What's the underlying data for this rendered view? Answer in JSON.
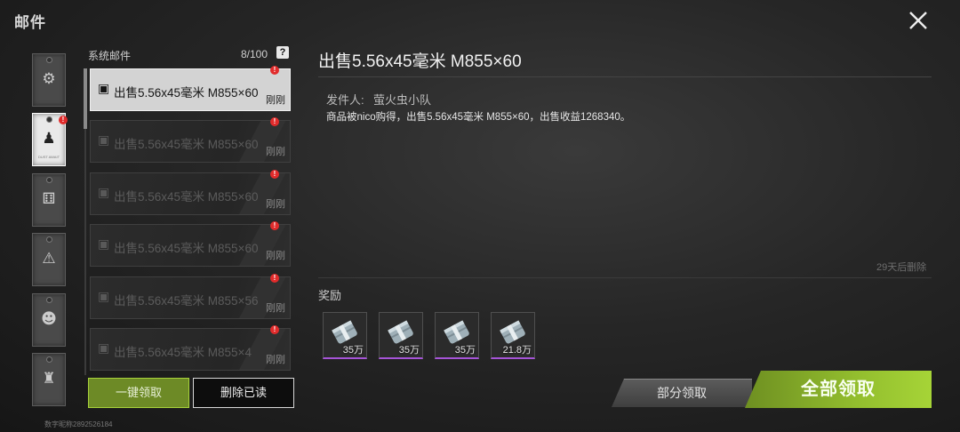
{
  "header": {
    "title": "邮件"
  },
  "tabs": [
    {
      "icon": "gear-icon",
      "glyph": "⚙",
      "active": false,
      "badge": ""
    },
    {
      "icon": "hazard-person-icon",
      "glyph": "♟",
      "active": true,
      "badge": "!",
      "caption": "DUST AWAIT"
    },
    {
      "icon": "dice-icon",
      "glyph": "⚅",
      "active": false,
      "badge": ""
    },
    {
      "icon": "warning-icon",
      "glyph": "⚠",
      "active": false,
      "badge": ""
    },
    {
      "icon": "helmet-icon",
      "glyph": "☻",
      "active": false,
      "badge": ""
    },
    {
      "icon": "backpack-icon",
      "glyph": "♜",
      "active": false,
      "badge": ""
    }
  ],
  "mail_list": {
    "header": "系统邮件",
    "count": "8/100",
    "help_label": "?",
    "items": [
      {
        "subject": "出售5.56x45毫米 M855×60",
        "time": "刚刚",
        "selected": true,
        "badge": "!"
      },
      {
        "subject": "出售5.56x45毫米 M855×60",
        "time": "刚刚",
        "selected": false,
        "badge": "!"
      },
      {
        "subject": "出售5.56x45毫米 M855×60",
        "time": "刚刚",
        "selected": false,
        "badge": "!"
      },
      {
        "subject": "出售5.56x45毫米 M855×60",
        "time": "刚刚",
        "selected": false,
        "badge": "!"
      },
      {
        "subject": "出售5.56x45毫米 M855×56",
        "time": "刚刚",
        "selected": false,
        "badge": "!"
      },
      {
        "subject": "出售5.56x45毫米 M855×4",
        "time": "刚刚",
        "selected": false,
        "badge": "!"
      }
    ],
    "claim_one_label": "一键领取",
    "delete_read_label": "删除已读"
  },
  "footer": {
    "digital_id": "数字昵称2892526184"
  },
  "detail": {
    "title": "出售5.56x45毫米 M855×60",
    "sender_label": "发件人:",
    "sender": "萤火虫小队",
    "body": "商品被nico购得，出售5.56x45毫米 M855×60，出售收益1268340。",
    "expire": "29天后删除",
    "rewards_label": "奖励",
    "rewards": [
      {
        "icon": "money-roll-icon",
        "amount": "35万"
      },
      {
        "icon": "money-roll-icon",
        "amount": "35万"
      },
      {
        "icon": "money-roll-icon",
        "amount": "35万"
      },
      {
        "icon": "money-roll-icon",
        "amount": "21.8万"
      }
    ],
    "partial_claim_label": "部分领取",
    "claim_all_label": "全部领取"
  },
  "colors": {
    "accent_green": "#93be2e",
    "badge_red": "#e12b2b",
    "rarity_purple": "#a654d8"
  }
}
